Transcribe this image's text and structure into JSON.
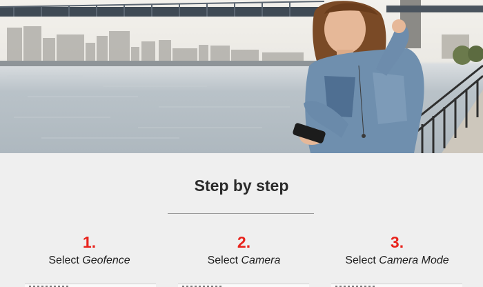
{
  "hero": {
    "alt": "Woman holding a smartphone on a riverside walkway"
  },
  "section": {
    "title": "Step by step"
  },
  "steps": [
    {
      "number": "1.",
      "prefix": "Select",
      "term": "Geofence"
    },
    {
      "number": "2.",
      "prefix": "Select",
      "term": "Camera"
    },
    {
      "number": "3.",
      "prefix": "Select",
      "term": "Camera Mode"
    }
  ],
  "colors": {
    "step_number": "#e8231c",
    "page_background": "#efefef",
    "title_text": "#2b2b2b"
  }
}
